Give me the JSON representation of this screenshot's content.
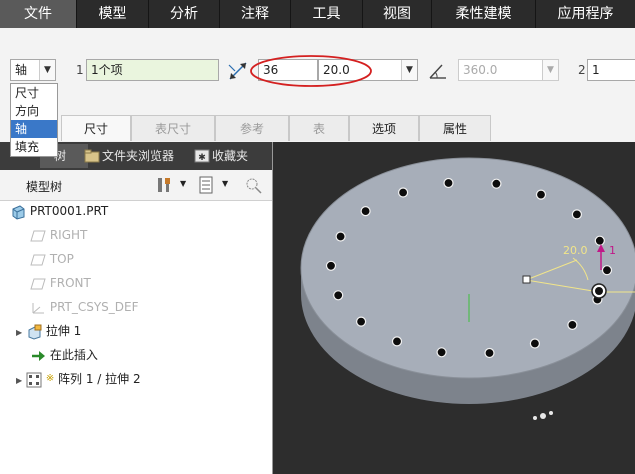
{
  "menubar": {
    "items": [
      "文件",
      "模型",
      "分析",
      "注释",
      "工具",
      "视图",
      "柔性建模",
      "应用程序"
    ]
  },
  "dashboard": {
    "pattern_type": "轴",
    "pattern_options": [
      "尺寸",
      "方向",
      "轴",
      "填充"
    ],
    "selected_option": "轴",
    "first_direction_index": "1",
    "first_direction_value": "1个项",
    "member_count": "36",
    "angle_value": "20.0",
    "total_angle": "360.0",
    "second_direction_index": "2",
    "second_direction_value": "1"
  },
  "tabs": [
    "尺寸",
    "表尺寸",
    "参考",
    "表",
    "选项",
    "属性"
  ],
  "disabled_tabs": [
    "表尺寸",
    "参考",
    "表"
  ],
  "navigator": {
    "tabs": [
      "树",
      "文件夹浏览器",
      "收藏夹"
    ],
    "title": "模型树"
  },
  "tree": {
    "root": "PRT0001.PRT",
    "items": [
      "RIGHT",
      "TOP",
      "FRONT",
      "PRT_CSYS_DEF",
      "拉伸 1",
      "在此插入",
      "阵列 1 / 拉伸 2"
    ]
  },
  "viewport": {
    "dimension_label": "20.0",
    "marker_label": "1",
    "hole_count": 18
  },
  "colors": {
    "menubar": "#2b2b2b",
    "active_menu": "#5a5a5a",
    "highlight_circle": "#d42020",
    "part_face": "#a7aeb9",
    "part_side": "#7d838c",
    "viewport_bg": "#2d2d2d",
    "selection_blue": "#3a78c8"
  },
  "icons": [
    "angle-icon",
    "dimension-icon",
    "tree-settings-icon",
    "show-icon",
    "filter-icon",
    "part-icon",
    "datum-plane-icon",
    "csys-icon",
    "extrude-icon",
    "insert-arrow-icon",
    "pattern-icon",
    "folder-icon",
    "favorites-icon"
  ]
}
